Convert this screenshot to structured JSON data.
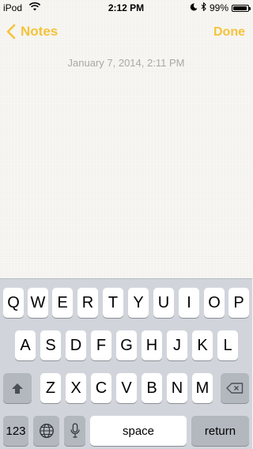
{
  "status_bar": {
    "carrier": "iPod",
    "time": "2:12 PM",
    "battery_percent": "99%",
    "battery_level": 0.99,
    "icons": [
      "wifi-icon",
      "moon-icon",
      "bluetooth-icon",
      "battery-icon"
    ]
  },
  "nav": {
    "back_label": "Notes",
    "done_label": "Done",
    "accent_color": "#f5c33b"
  },
  "note": {
    "date": "January 7, 2014, 2:11 PM",
    "body": ""
  },
  "keyboard": {
    "row1": [
      "Q",
      "W",
      "E",
      "R",
      "T",
      "Y",
      "U",
      "I",
      "O",
      "P"
    ],
    "row2": [
      "A",
      "S",
      "D",
      "F",
      "G",
      "H",
      "J",
      "K",
      "L"
    ],
    "row3": [
      "Z",
      "X",
      "C",
      "V",
      "B",
      "N",
      "M"
    ],
    "numbers_label": "123",
    "space_label": "space",
    "return_label": "return",
    "icons": [
      "shift-icon",
      "backspace-icon",
      "globe-icon",
      "mic-icon"
    ]
  }
}
